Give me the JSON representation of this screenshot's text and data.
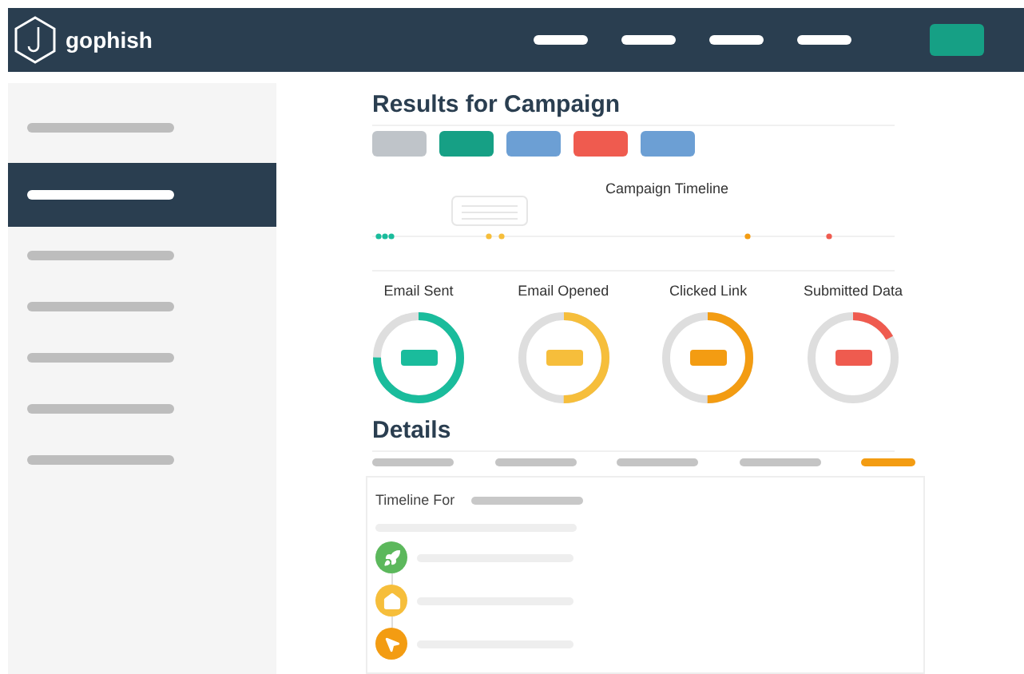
{
  "header": {
    "brand": "gophish"
  },
  "sidebar": {
    "items": [
      {
        "selected": false
      },
      {
        "selected": true
      },
      {
        "selected": false
      },
      {
        "selected": false
      },
      {
        "selected": false
      },
      {
        "selected": false
      },
      {
        "selected": false
      }
    ]
  },
  "title": "Results for Campaign",
  "actions": [
    {
      "color": "#bfc4c9"
    },
    {
      "color": "#16a085"
    },
    {
      "color": "#6c9fd4"
    },
    {
      "color": "#ef5b4f"
    },
    {
      "color": "#6c9fd4"
    }
  ],
  "timeline": {
    "title": "Campaign Timeline"
  },
  "stats": [
    {
      "label": "Email Sent",
      "color": "#1abc9c"
    },
    {
      "label": "Email Opened",
      "color": "#f6be3b"
    },
    {
      "label": "Clicked Link",
      "color": "#f39c12"
    },
    {
      "label": "Submitted Data",
      "color": "#ef5b4f"
    }
  ],
  "details": {
    "title": "Details",
    "tabs": [
      {
        "selected": false
      },
      {
        "selected": false
      },
      {
        "selected": false
      },
      {
        "selected": false
      },
      {
        "selected": true
      }
    ]
  },
  "user_timeline": {
    "label": "Timeline For",
    "events": [
      {
        "kind": "launch",
        "color": "#5cb85c"
      },
      {
        "kind": "open",
        "color": "#f6be3b"
      },
      {
        "kind": "click",
        "color": "#f39c12"
      }
    ]
  }
}
